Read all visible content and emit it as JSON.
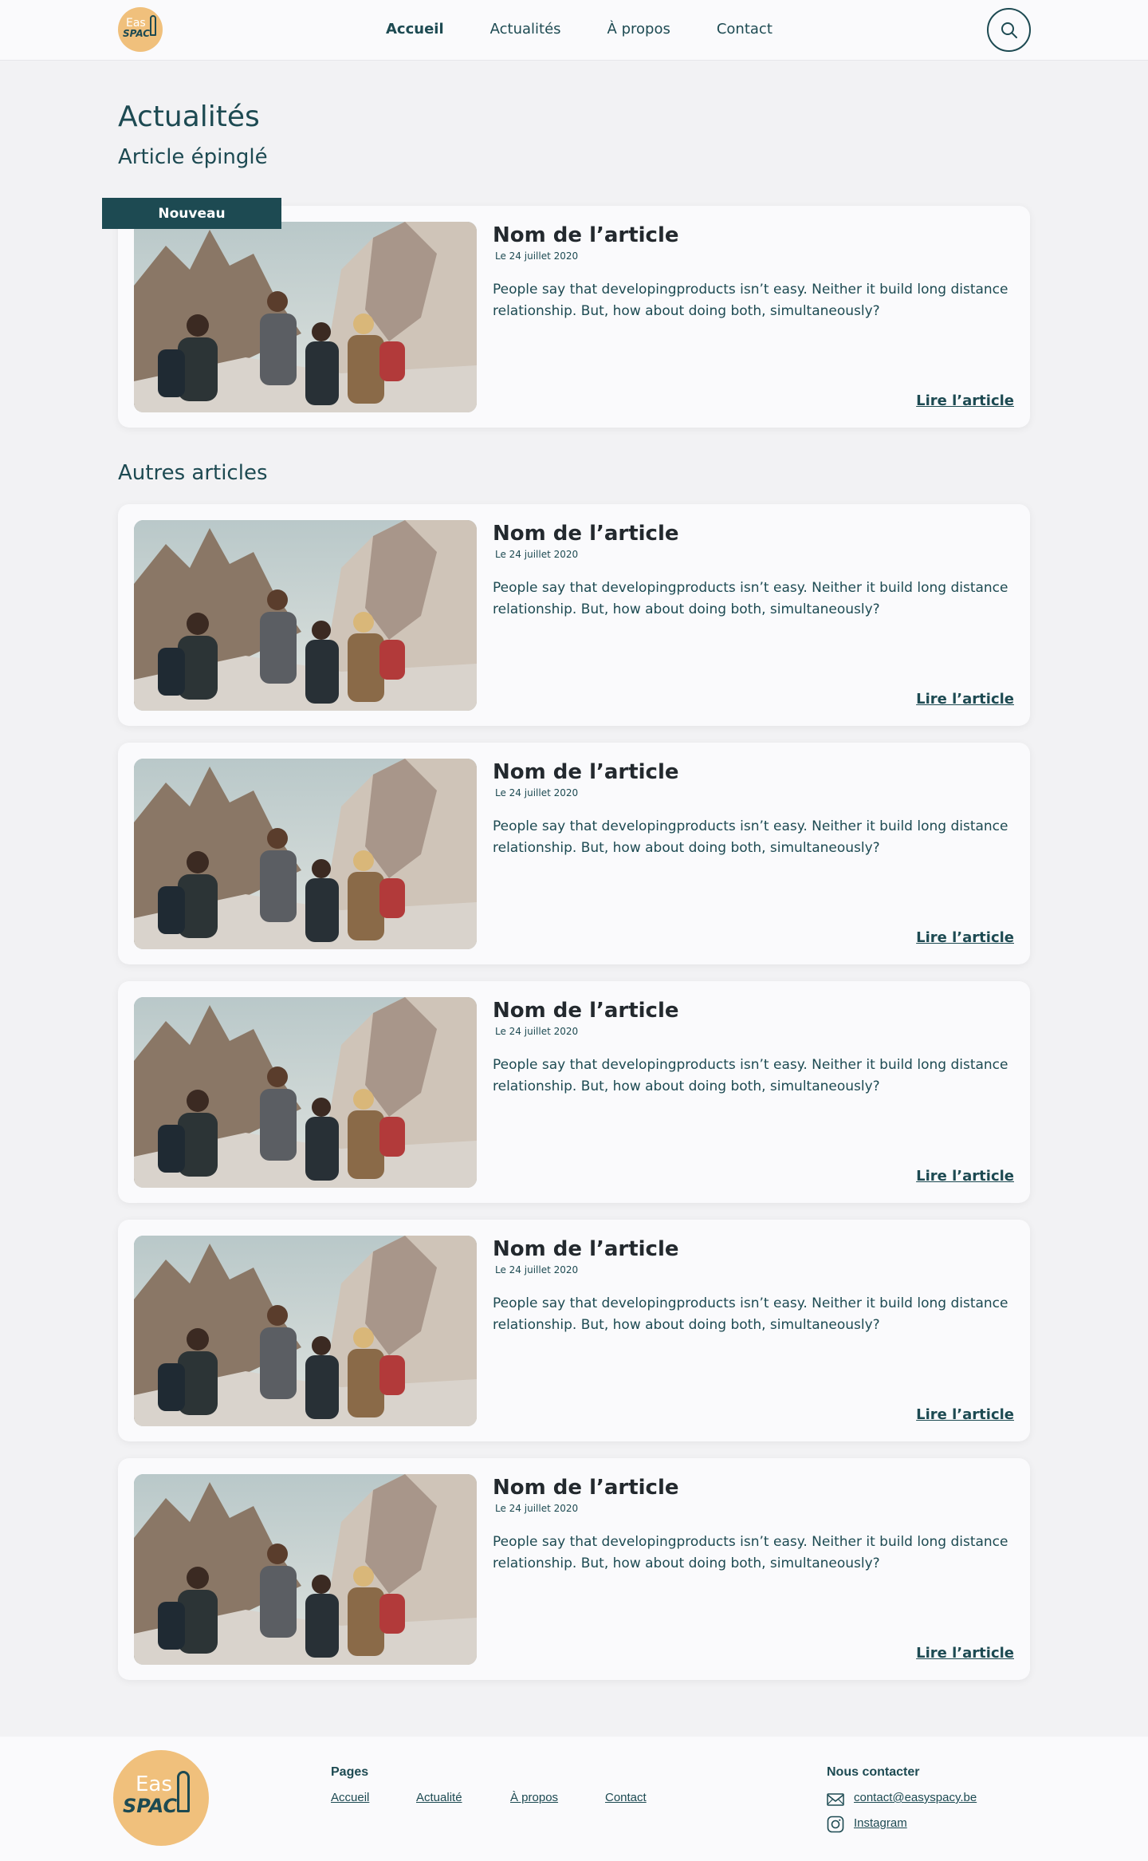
{
  "header": {
    "logo_top": "Eas",
    "logo_bottom": "SPAC",
    "nav": [
      {
        "label": "Accueil",
        "active": true
      },
      {
        "label": "Actualités",
        "active": false
      },
      {
        "label": "À propos",
        "active": false
      },
      {
        "label": "Contact",
        "active": false
      }
    ],
    "search_icon": "search-icon"
  },
  "page_title": "Actualités",
  "pinned": {
    "section_title": "Article épinglé",
    "badge": "Nouveau",
    "article": {
      "title": "Nom de l’article",
      "date": "Le 24 juillet 2020",
      "text": "People say that developingproducts isn’t easy. Neither it build long distance relationship. But, how about doing both, simultaneously?",
      "link": "Lire l’article"
    }
  },
  "others": {
    "section_title": "Autres articles",
    "articles": [
      {
        "title": "Nom de l’article",
        "date": "Le 24 juillet 2020",
        "text": "People say that developingproducts isn’t easy. Neither it build long distance relationship. But, how about doing both, simultaneously?",
        "link": "Lire l’article"
      },
      {
        "title": "Nom de l’article",
        "date": "Le 24 juillet 2020",
        "text": "People say that developingproducts isn’t easy. Neither it build long distance relationship. But, how about doing both, simultaneously?",
        "link": "Lire l’article"
      },
      {
        "title": "Nom de l’article",
        "date": "Le 24 juillet 2020",
        "text": "People say that developingproducts isn’t easy. Neither it build long distance relationship. But, how about doing both, simultaneously?",
        "link": "Lire l’article"
      },
      {
        "title": "Nom de l’article",
        "date": "Le 24 juillet 2020",
        "text": "People say that developingproducts isn’t easy. Neither it build long distance relationship. But, how about doing both, simultaneously?",
        "link": "Lire l’article"
      },
      {
        "title": "Nom de l’article",
        "date": "Le 24 juillet 2020",
        "text": "People say that developingproducts isn’t easy. Neither it build long distance relationship. But, how about doing both, simultaneously?",
        "link": "Lire l’article"
      }
    ]
  },
  "footer": {
    "logo_top": "Eas",
    "logo_bottom": "SPAC",
    "pages_heading": "Pages",
    "pages": [
      "Accueil",
      "Actualité",
      "À propos",
      "Contact"
    ],
    "contact_heading": "Nous contacter",
    "email": "contact@easyspacy.be",
    "instagram": "Instagram"
  },
  "colors": {
    "primary": "#1d4a52",
    "logo_bg": "#f0c07c",
    "page_bg": "#f2f2f4",
    "card_bg": "#fafafc"
  }
}
